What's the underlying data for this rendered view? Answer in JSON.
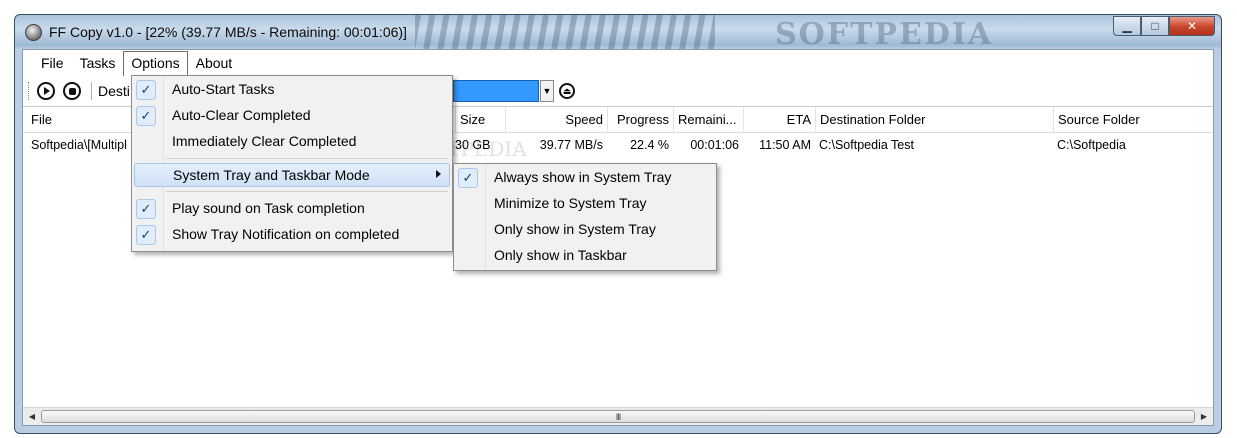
{
  "window": {
    "title": "FF Copy v1.0 - [22% (39.77 MB/s - Remaining: 00:01:06)]",
    "watermark": "SOFTPEDIA"
  },
  "menubar": {
    "file": "File",
    "tasks": "Tasks",
    "options": "Options",
    "about": "About"
  },
  "toolbar": {
    "destination_label": "Desti"
  },
  "list": {
    "columns": [
      "File",
      "Size",
      "Speed",
      "Progress",
      "Remaini...",
      "ETA",
      "Destination Folder",
      "Source Folder"
    ],
    "rows": [
      {
        "file": "Softpedia\\[Multipl",
        "size": "30 GB",
        "speed": "39.77 MB/s",
        "progress": "22.4 %",
        "remaining": "00:01:06",
        "eta": "11:50 AM",
        "destination": "C:\\Softpedia Test",
        "source": "C:\\Softpedia"
      }
    ],
    "watermark": "SOFTPEDIA"
  },
  "scrollbar": {
    "grip": "III"
  },
  "options_menu": {
    "check_glyph": "✓",
    "items": [
      {
        "label": "Auto-Start Tasks",
        "checked": true
      },
      {
        "label": "Auto-Clear Completed",
        "checked": true
      },
      {
        "label": "Immediately Clear Completed",
        "checked": false
      },
      {
        "label": "System Tray and Taskbar Mode",
        "checked": false,
        "submenu": true
      },
      {
        "label": "Play sound on Task completion",
        "checked": true
      },
      {
        "label": "Show Tray Notification on completed",
        "checked": true
      }
    ]
  },
  "tray_submenu": {
    "items": [
      {
        "label": "Always show in System Tray",
        "checked": true
      },
      {
        "label": "Minimize to System Tray",
        "checked": false
      },
      {
        "label": "Only show in System Tray",
        "checked": false
      },
      {
        "label": "Only show in Taskbar",
        "checked": false
      }
    ]
  },
  "icons": {
    "app": "app-disc-icon",
    "start": "play-icon",
    "stop": "stop-icon",
    "eject": "eject-icon",
    "submenu": "chevron-right-icon"
  },
  "colors": {
    "highlight": "#3399ff",
    "close_button": "#c8452c"
  }
}
